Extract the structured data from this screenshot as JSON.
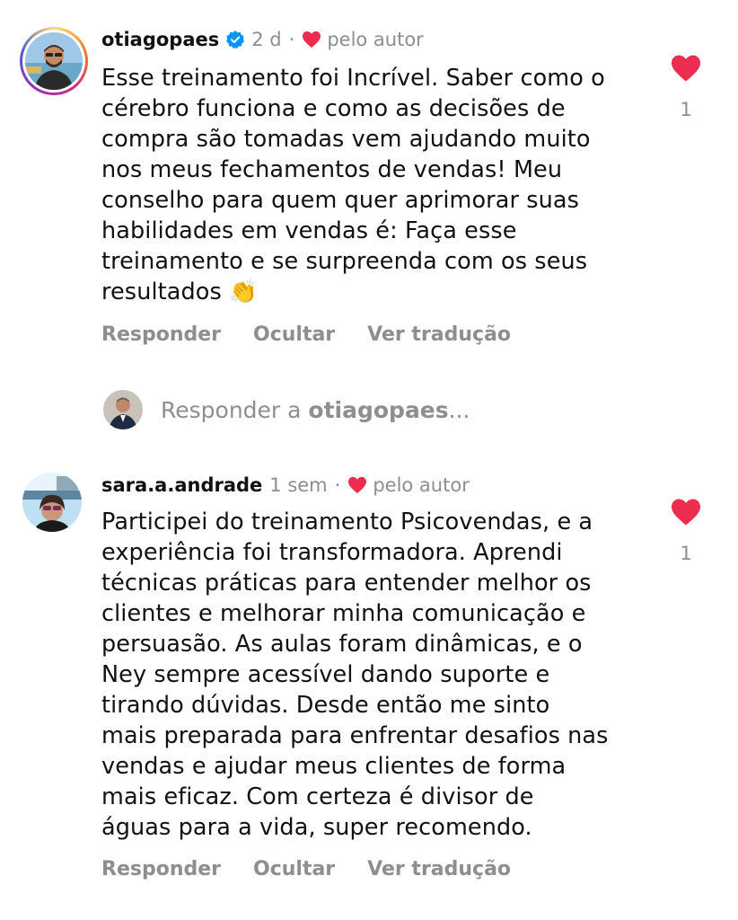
{
  "comments": [
    {
      "username": "otiagopaes",
      "verified": true,
      "time": "2 d",
      "separator": "·",
      "liked_by_author": "pelo autor",
      "text": "Esse treinamento foi Incrível. Saber como o\ncérebro funciona e como as decisões de\ncompra são tomadas vem ajudando muito\nnos meus fechamentos de vendas! Meu\nconselho para quem quer aprimorar suas\nhabilidades em vendas é: Faça esse\ntreinamento e se surpreenda com os seus\nresultados 👏",
      "actions": {
        "reply": "Responder",
        "hide": "Ocultar",
        "translate": "Ver tradução"
      },
      "like_count": "1"
    },
    {
      "username": "sara.a.andrade",
      "verified": false,
      "time": "1 sem",
      "separator": "·",
      "liked_by_author": "pelo autor",
      "text": "Participei do treinamento Psicovendas, e a\nexperiência foi transformadora. Aprendi\ntécnicas práticas para entender melhor os\nclientes e melhorar minha comunicação e\npersuasão. As aulas foram dinâmicas, e o\nNey sempre acessível dando suporte e\ntirando dúvidas. Desde então me sinto\nmais preparada para enfrentar desafios nas\nvendas e ajudar meus clientes de forma\nmais eficaz. Com certeza é divisor de\náguas para a vida, super recomendo.",
      "actions": {
        "reply": "Responder",
        "hide": "Ocultar",
        "translate": "Ver tradução"
      },
      "like_count": "1"
    }
  ],
  "reply_box": {
    "prefix": "Responder a ",
    "target": "otiagopaes",
    "suffix": "..."
  },
  "colors": {
    "heart": "#ed2d4f",
    "verified": "#0095f6",
    "muted": "#8e8e8e",
    "text": "#111111"
  }
}
